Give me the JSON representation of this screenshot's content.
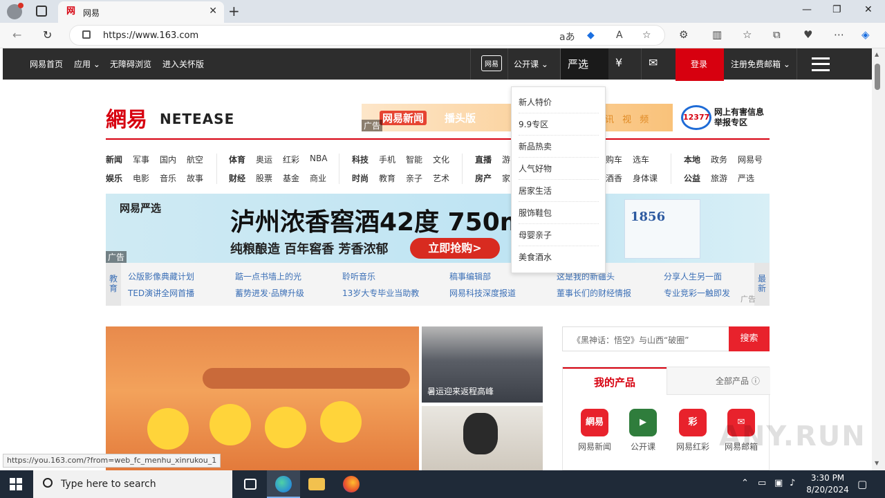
{
  "browser": {
    "tab_title": "网易",
    "tab_favicon": "网",
    "url": "https://www.163.com",
    "read_aloud": "A",
    "translate": "aあ"
  },
  "topnav": {
    "items": [
      "网易首页",
      "应用",
      "无障碍浏览",
      "进入关怀版"
    ],
    "right_items": [
      "网易",
      "公开课",
      "严选",
      "¥",
      "✉"
    ],
    "login": "登录",
    "register": "注册免费邮箱"
  },
  "dropdown": [
    "新人特价",
    "9.9专区",
    "新品热卖",
    "人气好物",
    "居家生活",
    "服饰鞋包",
    "母婴亲子",
    "美食酒水"
  ],
  "logo": {
    "cn": "網易",
    "en": "NETEASE"
  },
  "ad1": {
    "t1": "网易新闻",
    "t2": "播头版",
    "t3": "讯 视 频",
    "tag": "广告"
  },
  "report": {
    "badge": "12377",
    "text": "网上有害信息举报专区"
  },
  "channels": {
    "row1": [
      "新闻",
      "军事",
      "国内",
      "航空",
      "体育",
      "奥运",
      "红彩",
      "NBA",
      "科技",
      "手机",
      "智能",
      "文化",
      "直播",
      "游",
      "购车",
      "选车",
      "本地",
      "政务",
      "网易号"
    ],
    "row2": [
      "娱乐",
      "电影",
      "音乐",
      "故事",
      "财经",
      "股票",
      "基金",
      "商业",
      "时尚",
      "教育",
      "亲子",
      "艺术",
      "房产",
      "家",
      "酒香",
      "身体课",
      "公益",
      "旅游",
      "严选"
    ]
  },
  "bigad": {
    "brand": "网易严选",
    "head": "泸州浓香窖酒42度 750m",
    "sub": "纯粮酿造 百年窖香 芳香浓郁",
    "button": "立即抢购>",
    "bottle": "1856",
    "tag": "广告"
  },
  "edu": {
    "left": "教育",
    "right": "最新",
    "links": [
      "公版影像典藏计划",
      "踮一点书墙上的光",
      "聆听音乐",
      "稿事编辑部",
      "这是我的新疆头",
      "分享人生另一面",
      "TED演讲全网首播",
      "蓄势进发·品牌升级",
      "13岁大专毕业当助教",
      "网易科技深度报道",
      "董事长们的财经情报",
      "专业竞彩一触即发"
    ],
    "ad": "广告"
  },
  "photos": {
    "caption1": "暑运迎来返程高峰"
  },
  "search": {
    "placeholder": "《黑神话：悟空》与山西“破圈”",
    "button": "搜索"
  },
  "products": {
    "tab_active": "我的产品",
    "tab_all": "全部产品",
    "items": [
      {
        "label": "网易新闻",
        "icon": "網易",
        "color": "#e8222c"
      },
      {
        "label": "公开课",
        "icon": "▶",
        "color": "#2f7d3c"
      },
      {
        "label": "网易红彩",
        "icon": "彩",
        "color": "#e8222c"
      },
      {
        "label": "网易邮箱",
        "icon": "✉",
        "color": "#e8222c"
      }
    ]
  },
  "status_url": "https://you.163.com/?from=web_fc_menhu_xinrukou_1",
  "taskbar": {
    "search_placeholder": "Type here to search",
    "time": "3:30 PM",
    "date": "8/20/2024"
  },
  "watermark": "ANY.RUN"
}
